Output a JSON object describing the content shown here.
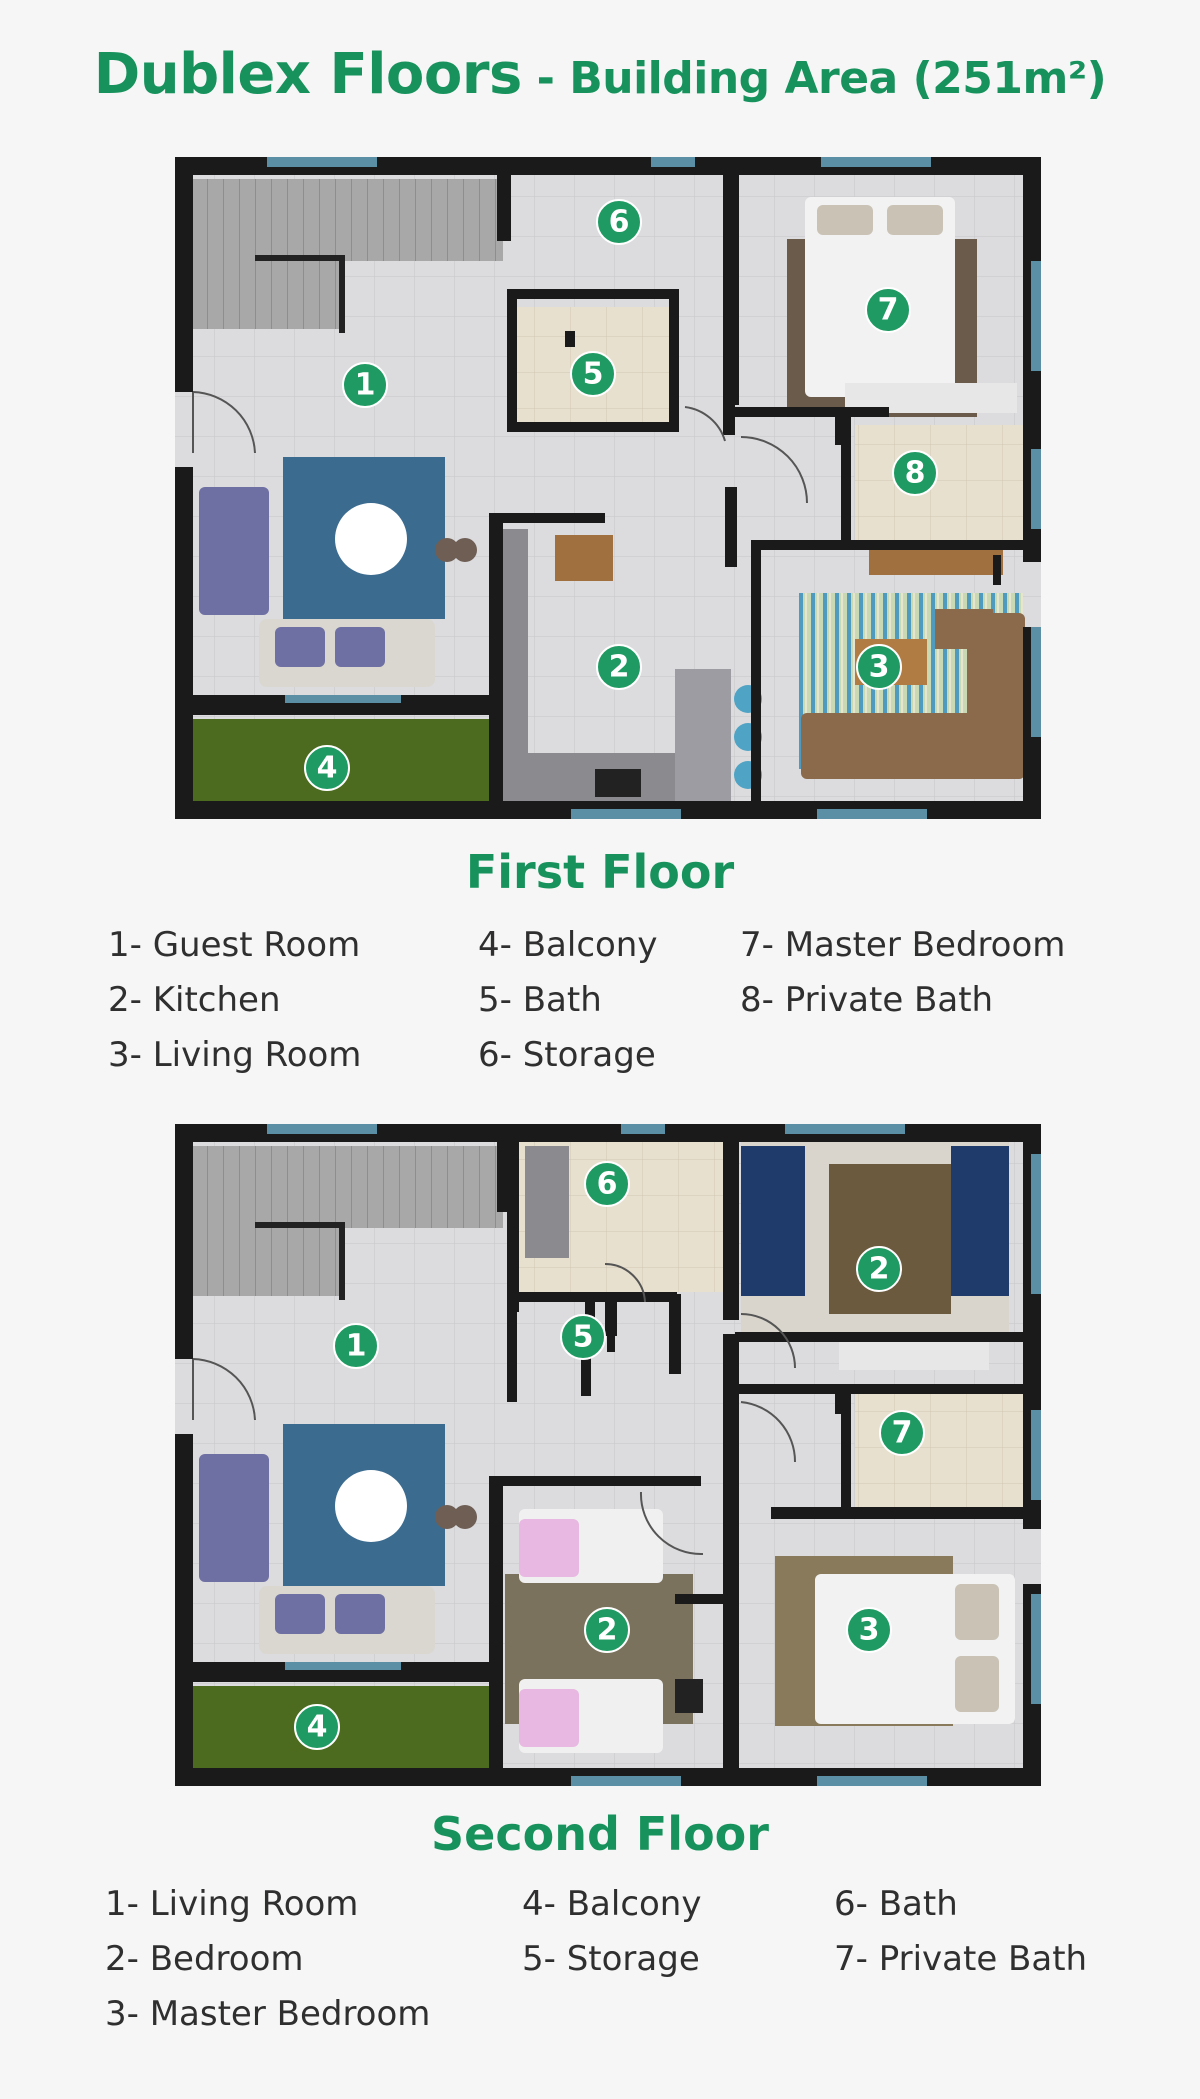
{
  "header": {
    "title_main": "Dublex Floors",
    "title_separator": " - ",
    "title_sub": "Building Area (251m²)"
  },
  "first_floor": {
    "title": "First Floor",
    "markers": [
      "1",
      "2",
      "3",
      "4",
      "5",
      "6",
      "7",
      "8"
    ],
    "legend": [
      "1- Guest Room",
      "2- Kitchen",
      "3- Living Room",
      "4- Balcony",
      "5- Bath",
      "6- Storage",
      "7- Master Bedroom",
      "8- Private Bath"
    ]
  },
  "second_floor": {
    "title": "Second Floor",
    "markers": [
      "1",
      "2",
      "2",
      "3",
      "4",
      "5",
      "6",
      "7"
    ],
    "legend": [
      "1- Living Room",
      "2- Bedroom",
      "3- Master Bedroom",
      "4- Balcony",
      "5- Storage",
      "6- Bath",
      "7- Private Bath"
    ]
  },
  "colors": {
    "accent": "#17925d",
    "marker": "#1f9a62",
    "wall": "#1a1a1a",
    "window": "#5a8fa5",
    "floor_tile": "#dcdcdf",
    "balcony_grass": "#4d6b1f",
    "rug_blue": "#3b6b8f",
    "sofa_purple": "#6e6fa3"
  }
}
